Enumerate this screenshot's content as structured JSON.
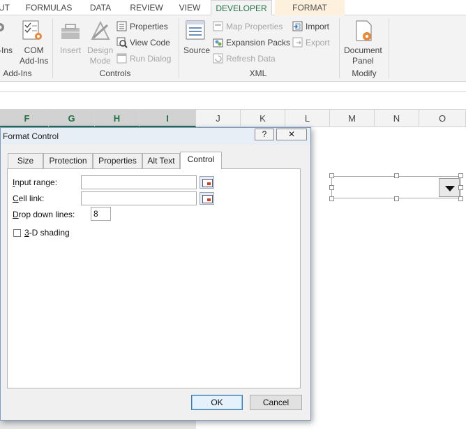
{
  "ribbon_tabs": [
    "UT",
    "FORMULAS",
    "DATA",
    "REVIEW",
    "VIEW",
    "DEVELOPER",
    "FORMAT"
  ],
  "addins_group": {
    "addins_label": "-Ins",
    "com_label_1": "COM",
    "com_label_2": "Add-Ins",
    "group_label": "Add-Ins"
  },
  "controls_group": {
    "insert_label": "Insert",
    "design_label_1": "Design",
    "design_label_2": "Mode",
    "properties_label": "Properties",
    "view_code_label": "View Code",
    "run_dialog_label": "Run Dialog",
    "group_label": "Controls"
  },
  "xml_group": {
    "source_label": "Source",
    "map_properties_label": "Map Properties",
    "expansion_packs_label": "Expansion Packs",
    "refresh_data_label": "Refresh Data",
    "import_label": "Import",
    "export_label": "Export",
    "group_label": "XML"
  },
  "modify_group": {
    "document_label": "Document",
    "panel_label": "Panel",
    "group_label": "Modify"
  },
  "columns": [
    "F",
    "G",
    "H",
    "I",
    "J",
    "K",
    "L",
    "M",
    "N",
    "O"
  ],
  "dialog": {
    "title": "Format Control",
    "help_label": "?",
    "close_label": "✕",
    "tabs": [
      "Size",
      "Protection",
      "Properties",
      "Alt Text",
      "Control"
    ],
    "input_range_label_u": "I",
    "input_range_label_rest": "nput range:",
    "cell_link_label_u": "C",
    "cell_link_label_rest": "ell link:",
    "drop_down_lines_label_u": "D",
    "drop_down_lines_label_rest": "rop down lines:",
    "drop_down_lines_value": "8",
    "shading_label_u": "3",
    "shading_label_rest": "-D shading",
    "ok_label": "OK",
    "cancel_label": "Cancel"
  },
  "colors": {
    "accent": "#217346",
    "format_tab_bg": "#fdf0dc"
  }
}
